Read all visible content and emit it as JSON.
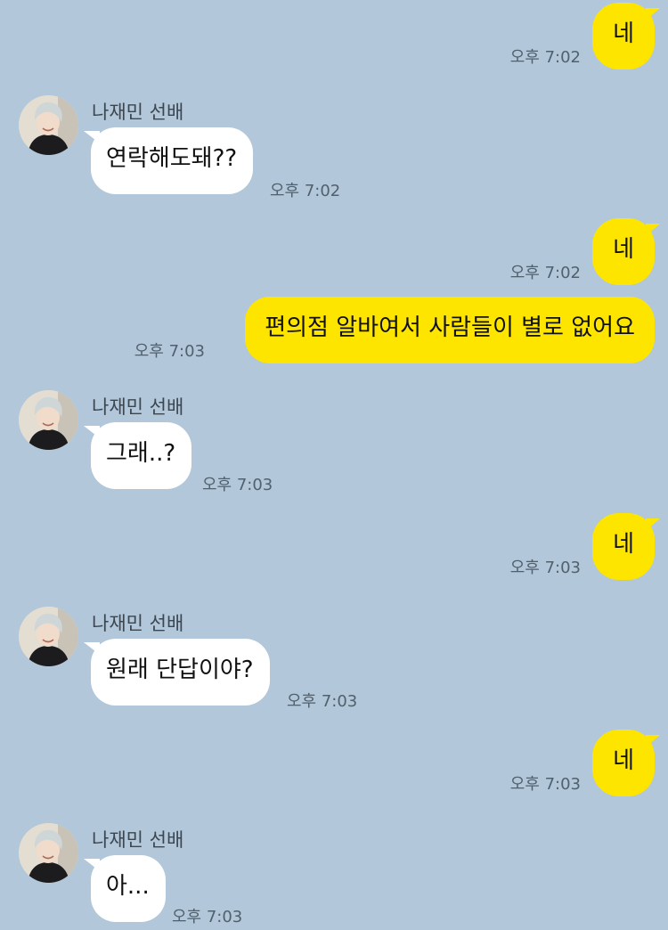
{
  "sender": {
    "name": "나재민 선배"
  },
  "messages": [
    {
      "dir": "out",
      "text": "네",
      "time": "오후 7:02"
    },
    {
      "dir": "in",
      "text": "연락해도돼??",
      "time": "오후 7:02"
    },
    {
      "dir": "out",
      "text": "네",
      "time": "오후 7:02"
    },
    {
      "dir": "out",
      "text": "편의점 알바여서 사람들이 별로 없어요",
      "time": "오후 7:03"
    },
    {
      "dir": "in",
      "text": "그래..?",
      "time": "오후 7:03"
    },
    {
      "dir": "out",
      "text": "네",
      "time": "오후 7:03"
    },
    {
      "dir": "in",
      "text": "원래 단답이야?",
      "time": "오후 7:03"
    },
    {
      "dir": "out",
      "text": "네",
      "time": "오후 7:03"
    },
    {
      "dir": "in",
      "text": "아...",
      "time": "오후 7:03"
    }
  ],
  "colors": {
    "background": "#b2c7d9",
    "outgoing_bubble": "#fee500",
    "incoming_bubble": "#ffffff"
  }
}
